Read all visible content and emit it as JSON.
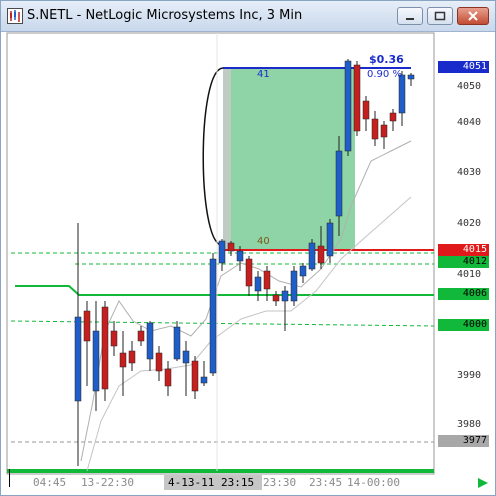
{
  "window": {
    "title": "S.NETL - NetLogic Microsystems Inc, 3 Min"
  },
  "price_axis": {
    "labels": [
      "4051",
      "4050",
      "4040",
      "4030",
      "4020",
      "4015",
      "4012",
      "4010",
      "4006",
      "4000",
      "3990",
      "3980",
      "3977"
    ],
    "tags": {
      "current": "4051",
      "red": "4015",
      "green1": "4012",
      "green2": "4006",
      "green3": "4000",
      "gray": "3977"
    }
  },
  "time_axis": {
    "labels": [
      "04:45",
      "13-22:30",
      "23:15",
      "23:30",
      "23:45",
      "14-00:00"
    ],
    "cursor": "4-13-11 23:15"
  },
  "annotations": {
    "gain": "$0.36",
    "pct": "0.90 %",
    "top_count": "41",
    "bottom_count": "40"
  },
  "colors": {
    "up_candle": "#1f5ec8",
    "down_candle": "#c42020",
    "green_line": "#12b83a",
    "red_line": "#e01a1a",
    "range_fill": "#8fd4a6",
    "top_line": "#1a2bcc"
  }
}
